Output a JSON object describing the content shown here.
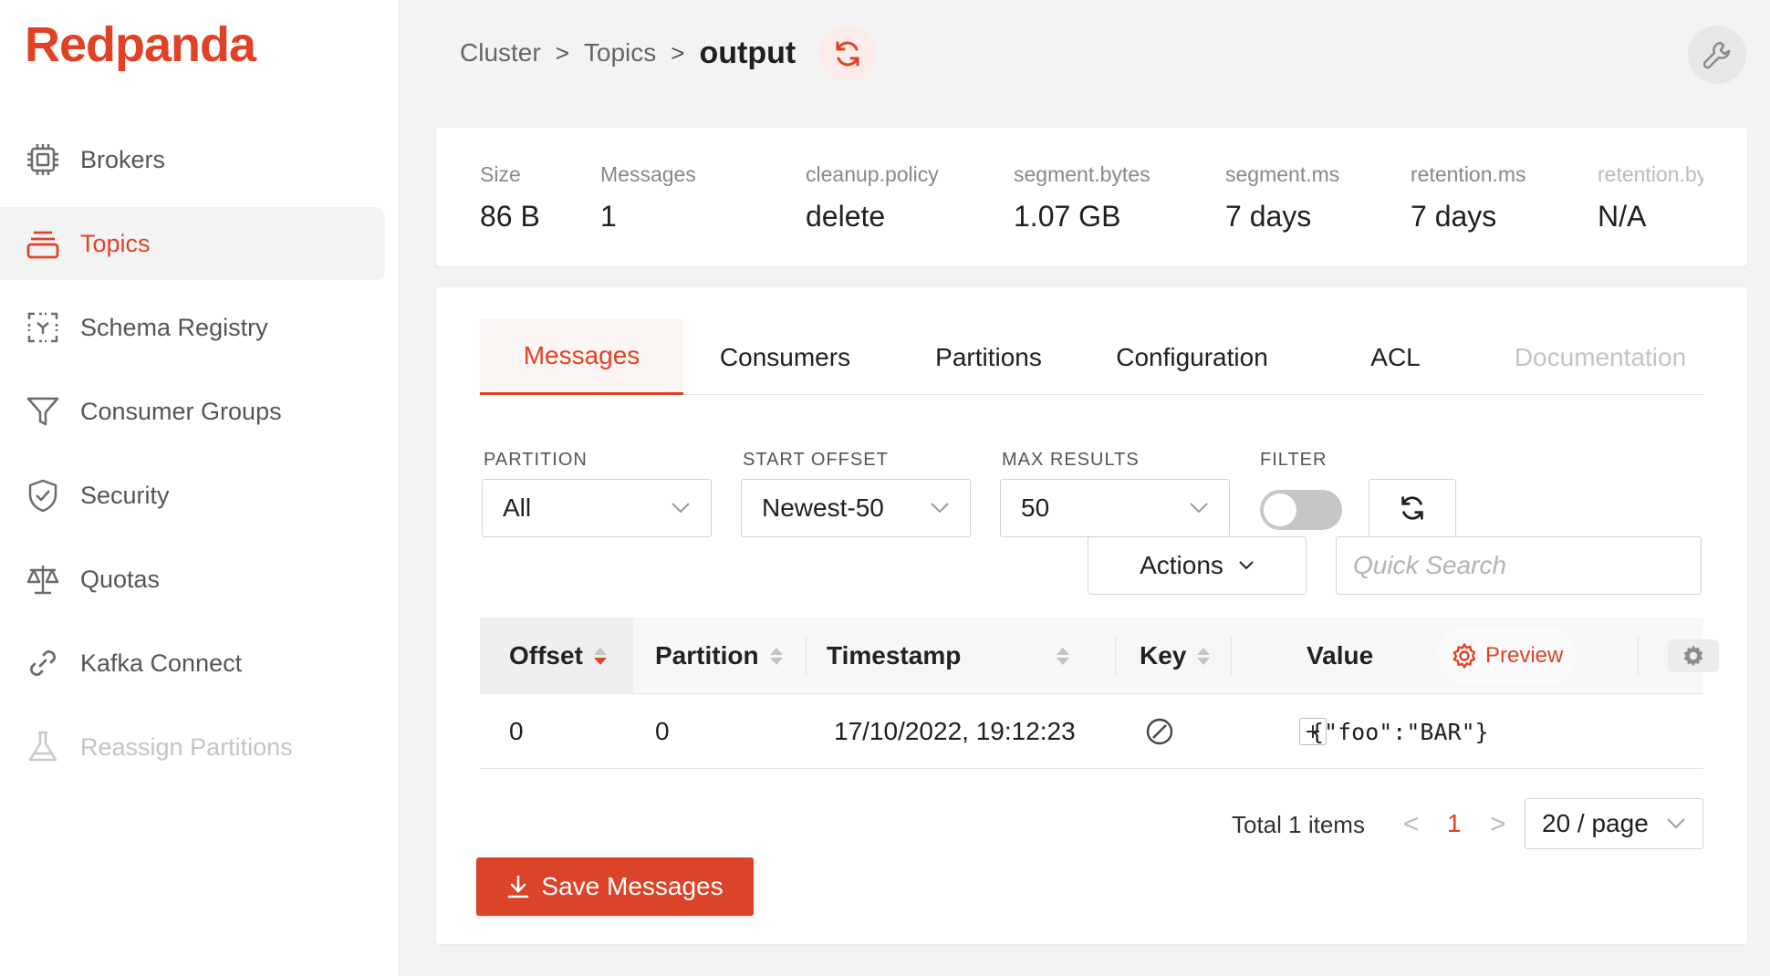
{
  "app": {
    "logo": "Redpanda",
    "brand_color": "#e14226"
  },
  "sidebar": {
    "items": [
      {
        "label": "Brokers",
        "icon": "chip-icon"
      },
      {
        "label": "Topics",
        "icon": "inbox-icon",
        "active": true
      },
      {
        "label": "Schema Registry",
        "icon": "schema-icon"
      },
      {
        "label": "Consumer Groups",
        "icon": "funnel-icon"
      },
      {
        "label": "Security",
        "icon": "shield-icon"
      },
      {
        "label": "Quotas",
        "icon": "scale-icon"
      },
      {
        "label": "Kafka Connect",
        "icon": "link-icon"
      },
      {
        "label": "Reassign Partitions",
        "icon": "flask-icon",
        "disabled": true
      }
    ]
  },
  "breadcrumb": {
    "items": [
      "Cluster",
      "Topics"
    ],
    "separator": ">",
    "current": "output"
  },
  "stats": [
    {
      "label": "Size",
      "value": "86 B"
    },
    {
      "label": "Messages",
      "value": "1"
    },
    {
      "label": "cleanup.policy",
      "value": "delete"
    },
    {
      "label": "segment.bytes",
      "value": "1.07 GB"
    },
    {
      "label": "segment.ms",
      "value": "7 days"
    },
    {
      "label": "retention.ms",
      "value": "7 days"
    },
    {
      "label": "retention.bytes",
      "value": "N/A"
    }
  ],
  "tabs": [
    "Messages",
    "Consumers",
    "Partitions",
    "Configuration",
    "ACL",
    "Documentation"
  ],
  "filters": {
    "partition": {
      "label": "PARTITION",
      "value": "All"
    },
    "start_offset": {
      "label": "START OFFSET",
      "value": "Newest-50"
    },
    "max_results": {
      "label": "MAX RESULTS",
      "value": "50"
    },
    "filter": {
      "label": "FILTER",
      "enabled": false
    },
    "actions_label": "Actions",
    "search_placeholder": "Quick Search"
  },
  "table": {
    "columns": [
      "Offset",
      "Partition",
      "Timestamp",
      "Key",
      "Value"
    ],
    "preview_label": "Preview",
    "rows": [
      {
        "offset": "0",
        "partition": "0",
        "timestamp": "17/10/2022, 19:12:23",
        "key": "null",
        "value": "{\"foo\":\"BAR\"}"
      }
    ]
  },
  "pagination": {
    "total": "Total 1 items",
    "current": "1",
    "prev": "<",
    "next": ">",
    "page_size": "20 / page"
  },
  "save_button": "Save Messages"
}
